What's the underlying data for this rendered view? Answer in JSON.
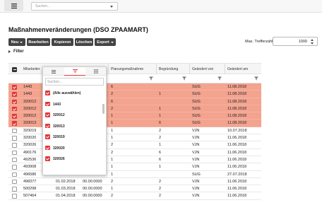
{
  "topbar": {
    "search_placeholder": "Suchen..."
  },
  "page": {
    "title": "Maßnahmenveränderungen (DSO ZPAAMART)"
  },
  "toolbar": {
    "new_label": "Neu",
    "edit_label": "Bearbeiten",
    "copy_label": "Kopieren",
    "delete_label": "Löschen",
    "export_label": "Export"
  },
  "max_hits": {
    "label": "Max. Trefferzahl",
    "value": "1000"
  },
  "filter": {
    "label": "Filter"
  },
  "columns": [
    "Mitarbeiter",
    "",
    "",
    "Planungsmaßnahme",
    "Begründung",
    "Geändert von",
    "Geändert am"
  ],
  "rows": [
    {
      "c0": "1443",
      "c1": "",
      "c2": "",
      "c3": "6",
      "c4": "",
      "c5": "SUG",
      "c6": "11.08.2018",
      "selected": true
    },
    {
      "c0": "1443",
      "c1": "",
      "c2": "",
      "c3": "2",
      "c4": "1",
      "c5": "SUG",
      "c6": "11.08.2018",
      "selected": true
    },
    {
      "c0": "320012",
      "c1": "",
      "c2": "",
      "c3": "6",
      "c4": "",
      "c5": "SUG",
      "c6": "11.08.2018",
      "selected": true
    },
    {
      "c0": "320012",
      "c1": "",
      "c2": "",
      "c3": "2",
      "c4": "1",
      "c5": "SUG",
      "c6": "11.08.2018",
      "selected": true
    },
    {
      "c0": "320012",
      "c1": "",
      "c2": "",
      "c3": "1",
      "c4": "1",
      "c5": "SUG",
      "c6": "11.08.2018",
      "selected": true
    },
    {
      "c0": "320013",
      "c1": "",
      "c2": "",
      "c3": "1",
      "c4": "6",
      "c5": "SUG",
      "c6": "11.08.2018",
      "selected": true
    },
    {
      "c0": "320019",
      "c1": "",
      "c2": "",
      "c3": "1",
      "c4": "2",
      "c5": "VJN",
      "c6": "10.07.2018",
      "selected": false
    },
    {
      "c0": "320020",
      "c1": "",
      "c2": "",
      "c3": "1",
      "c4": "2",
      "c5": "VJN",
      "c6": "11.06.2018",
      "selected": false
    },
    {
      "c0": "320026",
      "c1": "",
      "c2": "",
      "c3": "2",
      "c4": "1",
      "c5": "VJN",
      "c6": "11.06.2018",
      "selected": false
    },
    {
      "c0": "490176",
      "c1": "",
      "c2": "",
      "c3": "2",
      "c4": "6",
      "c5": "VJN",
      "c6": "11.06.2018",
      "selected": false
    },
    {
      "c0": "492536",
      "c1": "",
      "c2": "",
      "c3": "1",
      "c4": "6",
      "c5": "VJN",
      "c6": "11.06.2018",
      "selected": false
    },
    {
      "c0": "493908",
      "c1": "01.07.2018",
      "c2": "00.00.0000",
      "c3": "1",
      "c4": "1",
      "c5": "VJN",
      "c6": "11.06.2018",
      "selected": false
    },
    {
      "c0": "496586",
      "c1": "01.01.2018",
      "c2": "00.00.0000",
      "c3": "1",
      "c4": "",
      "c5": "SUG",
      "c6": "27.07.2018",
      "selected": false
    },
    {
      "c0": "498377",
      "c1": "01.02.2018",
      "c2": "00.00.0000",
      "c3": "2",
      "c4": "2",
      "c5": "VJN",
      "c6": "11.06.2018",
      "selected": false
    },
    {
      "c0": "500298",
      "c1": "01.03.2018",
      "c2": "00.00.0000",
      "c3": "1",
      "c4": "2",
      "c5": "VJN",
      "c6": "11.06.2018",
      "selected": false
    },
    {
      "c0": "507464",
      "c1": "01.04.2018",
      "c2": "00.00.0000",
      "c3": "2",
      "c4": "2",
      "c5": "VJN",
      "c6": "11.06.2018",
      "selected": false
    }
  ],
  "popup": {
    "tabs": [
      "menu-icon",
      "filter-icon",
      "columns-icon"
    ],
    "search_placeholder": "Suchen...",
    "select_all_label": "(Alle auswählen)",
    "items": [
      "1443",
      "320012",
      "320013",
      "320019",
      "320020",
      "320026"
    ]
  },
  "colors": {
    "accent": "#e0383a",
    "selected_row": "#f4a38f",
    "toolbar_button": "#444444"
  }
}
